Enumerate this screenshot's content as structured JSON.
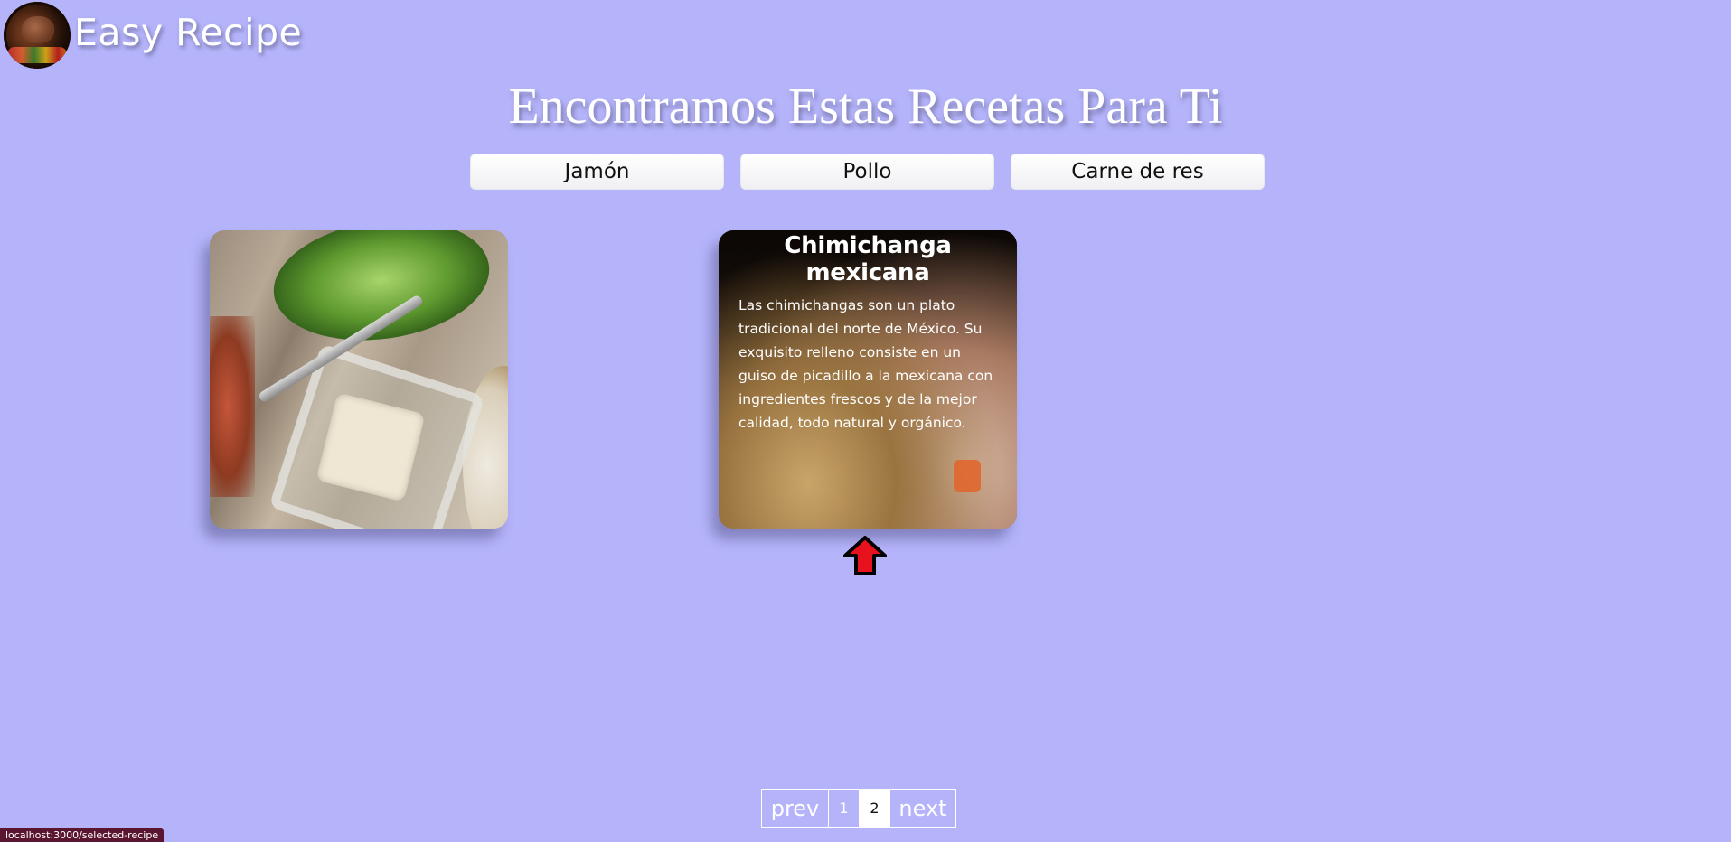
{
  "brand": {
    "title": "Easy Recipe",
    "logo_icon": "grilled-meat-logo"
  },
  "heading": "Encontramos Estas Recetas Para Ti",
  "filters": [
    {
      "label": "Jamón"
    },
    {
      "label": "Pollo"
    },
    {
      "label": "Carne de res"
    }
  ],
  "cards": [
    {
      "title": "",
      "description": "",
      "image": "salad-with-sauce-photo"
    },
    {
      "title": "Chimichanga mexicana",
      "description": "Las chimichangas son un plato tradicional del norte de México. Su exquisito relleno consiste en un guiso de picadillo a la mexicana con ingredientes frescos y de la mejor calidad, todo natural y orgánico.",
      "image": "chimichanga-photo"
    }
  ],
  "cursor_icon": "red-up-arrow-icon",
  "pagination": {
    "prev": "prev",
    "pages": [
      "1",
      "2"
    ],
    "current": "2",
    "next": "next"
  },
  "statusbar": {
    "url": "localhost:3000/selected-recipe"
  },
  "colors": {
    "background": "#b5b4fb",
    "heading_text": "#ffffff",
    "arrow": "#e8121e",
    "statusbar": "#5a1530"
  }
}
